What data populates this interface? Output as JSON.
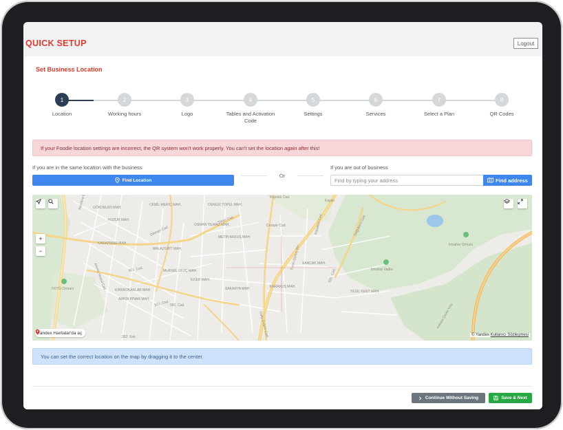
{
  "header": {
    "brand": "QUICK SETUP",
    "logout_label": "Logout"
  },
  "card": {
    "title": "Set Business Location"
  },
  "stepper": {
    "current": 1,
    "steps": [
      {
        "number": "1",
        "label": "Location"
      },
      {
        "number": "2",
        "label": "Working hours"
      },
      {
        "number": "3",
        "label": "Logo"
      },
      {
        "number": "4",
        "label": "Tables and Activation Code"
      },
      {
        "number": "5",
        "label": "Settings"
      },
      {
        "number": "6",
        "label": "Services"
      },
      {
        "number": "7",
        "label": "Select a Plan"
      },
      {
        "number": "8",
        "label": "QR Codes"
      }
    ]
  },
  "alerts": {
    "danger": "If your Foodie location settings are incorrect, the QR system won't work properly. You can't set the location again after this!",
    "info": "You can set the correct location on the map by dragging it to the center."
  },
  "location": {
    "same_label": "If you are in the same location with the business",
    "find_location_label": "Find Location",
    "or_label": "Or",
    "out_label": "If you are out of business",
    "address_placeholder": "Find by typing your address",
    "find_address_label": "Find address"
  },
  "map": {
    "zoom_in": "+",
    "zoom_out": "−",
    "yandex_link": "Yandex Haritalar'da aç",
    "copyright": "© Yandex",
    "terms": "Kullanıcı Sözleşmesi",
    "labels": [
      "Mevlana Blv.",
      "GÖKDELEN MAH.",
      "HUZUR MAH.",
      "CEMİL MERİÇ MAH.",
      "CENGİZ TOPEL MAH.",
      "OSMAN YILMAZ MAH.",
      "Dikmen Cad.",
      "Sinan Cad.",
      "METİN AKKUŞ MAH.",
      "KARAPINAR MAH.",
      "MALAZGİRT MAH.",
      "Ahmet Yesevi Cad.",
      "901. Cad.",
      "MURSEL ULUÇ MAH.",
      "İLKER MAH.",
      "DOTÜ Ormanı",
      "KIRKKONAKLAR MAH.",
      "ARKIN PINAR MAH.",
      "921. Cad.",
      "950. Cad.",
      "Cezayir Cad.",
      "Turan Güneş Blv.",
      "Kabaköz Cad.",
      "Köprülü Cad.",
      "Doğukent Cad.",
      "SANCAK MAH.",
      "SAKARYA MAH.",
      "KARAKUŞ MAH.",
      "555. Cad.",
      "YESİL KENT MAH.",
      "Galip Erdem Cad.",
      "İmrahor Vadisi",
      "İmrahor Ormanı",
      "Ankara Çevre Yolu",
      "352. Sok.",
      "Kayalı"
    ]
  },
  "footer": {
    "continue_label": "Continue Without Saving",
    "save_label": "Save & Next"
  },
  "colors": {
    "brand_red": "#e03a2f",
    "step_active": "#2c3e55",
    "primary_blue": "#3f87ef",
    "success_green": "#28a745",
    "secondary_gray": "#6c757d"
  }
}
